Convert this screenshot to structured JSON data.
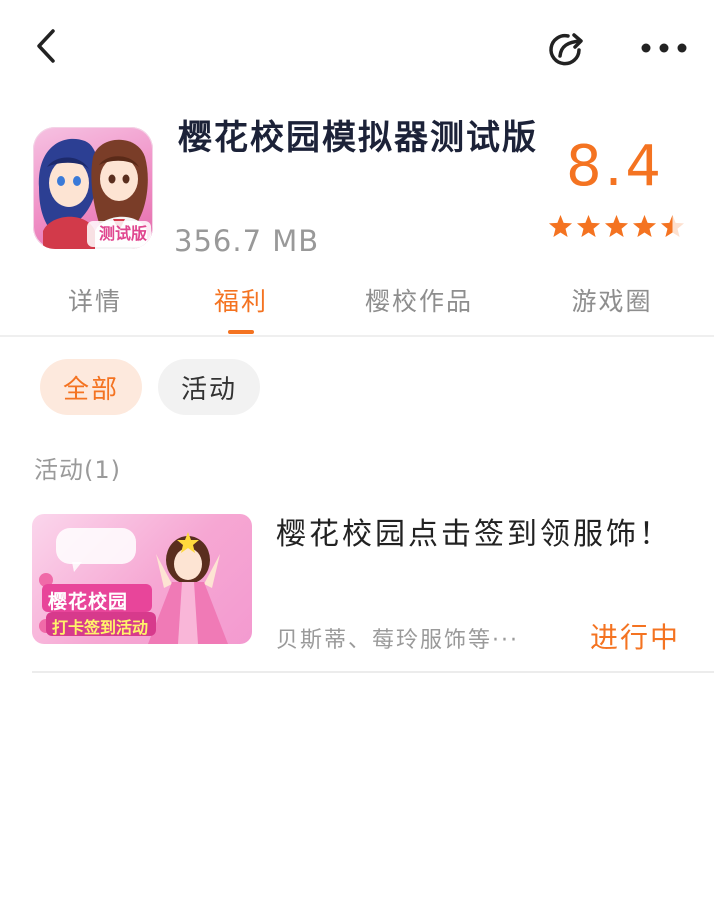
{
  "header": {
    "app_title": "樱花校园模拟器测试版",
    "app_size": "356.7 MB",
    "rating": "8.4",
    "stars": 4.5,
    "icon_badge": "测试版"
  },
  "tabs": [
    {
      "label": "详情",
      "active": false
    },
    {
      "label": "福利",
      "active": true
    },
    {
      "label": "樱校作品",
      "active": false
    },
    {
      "label": "游戏圈",
      "active": false
    }
  ],
  "filters": {
    "all": "全部",
    "activity": "活动"
  },
  "section": {
    "label": "活动(1)"
  },
  "activity_card": {
    "title": "樱花校园点击签到领服饰！",
    "desc": "贝斯蒂、莓玲服饰等···",
    "status": "进行中",
    "thumb_heading": "樱花校园",
    "thumb_subheading": "打卡签到活动"
  },
  "colors": {
    "accent": "#f47321",
    "title": "#1c2238",
    "muted": "#999999"
  },
  "icons": {
    "back": "chevron-left-icon",
    "share": "share-icon",
    "more": "more-icon",
    "star": "star-icon"
  }
}
